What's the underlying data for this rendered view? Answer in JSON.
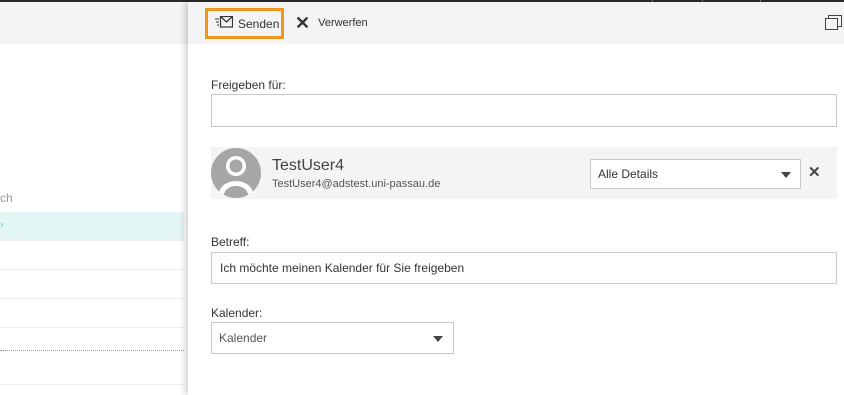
{
  "toolbar": {
    "send_label": "Senden",
    "discard_label": "Verwerfen"
  },
  "background": {
    "column_fragment": "ch"
  },
  "share": {
    "share_with_label": "Freigeben für:",
    "share_with_value": "",
    "recipient": {
      "name": "TestUser4",
      "email": "TestUser4@adstest.uni-passau.de",
      "permission": "Alle Details"
    },
    "subject_label": "Betreff:",
    "subject_value": "Ich möchte meinen Kalender für Sie freigeben",
    "calendar_label": "Kalender:",
    "calendar_value": "Kalender"
  },
  "icons": [
    "send-mail-icon",
    "close-icon",
    "popout-icon",
    "avatar-icon",
    "chevron-down-icon",
    "remove-icon"
  ],
  "colors": {
    "highlight_border": "#f0961f",
    "toolbar_bg": "#f4f4f4",
    "selected_row_bg": "#e3f6f5"
  }
}
